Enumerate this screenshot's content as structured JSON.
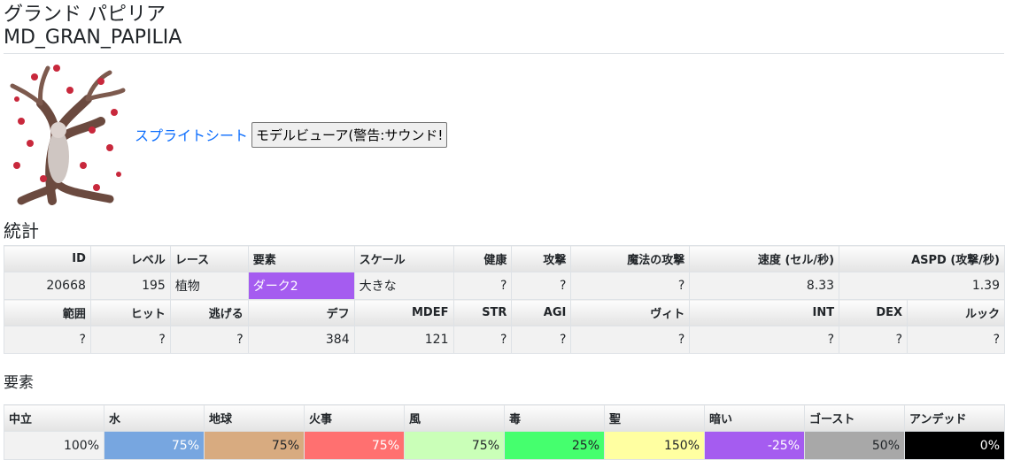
{
  "monster": {
    "name_jp": "グランド パピリア",
    "code": "MD_GRAN_PAPILIA",
    "sprite_link": "スプライトシート",
    "viewer_button": "モデルビューア(警告:サウンド!"
  },
  "stats": {
    "heading": "統計",
    "row1_headers": [
      "ID",
      "レベル",
      "レース",
      "要素",
      "スケール",
      "健康",
      "攻撃",
      "魔法の攻撃",
      "速度 (セル/秒)",
      "ASPD (攻撃/秒)"
    ],
    "row1_values": [
      "20668",
      "195",
      "植物",
      "ダーク2",
      "大きな",
      "?",
      "?",
      "?",
      "8.33",
      "1.39"
    ],
    "row2_headers": [
      "範囲",
      "ヒット",
      "逃げる",
      "デフ",
      "MDEF",
      "STR",
      "AGI",
      "ヴィト",
      "INT",
      "DEX",
      "ルック"
    ],
    "row2_values": [
      "?",
      "?",
      "?",
      "384",
      "121",
      "?",
      "?",
      "?",
      "?",
      "?",
      "?"
    ]
  },
  "elements": {
    "heading": "要素",
    "headers": [
      "中立",
      "水",
      "地球",
      "火事",
      "風",
      "毒",
      "聖",
      "暗い",
      "ゴースト",
      "アンデッド"
    ],
    "values": [
      "100%",
      "75%",
      "75%",
      "75%",
      "75%",
      "25%",
      "150%",
      "-25%",
      "50%",
      "0%"
    ],
    "colors": [
      "#f2f2f2",
      "#77a6e0",
      "#d8ab80",
      "#ff7070",
      "#caffb8",
      "#45ff6e",
      "#ffffa1",
      "#a55cf0",
      "#a8a8a8",
      "#000000"
    ],
    "text_colors": [
      "#212529",
      "#ffffff",
      "#212529",
      "#ffffff",
      "#212529",
      "#212529",
      "#212529",
      "#ffffff",
      "#212529",
      "#ffffff"
    ]
  }
}
